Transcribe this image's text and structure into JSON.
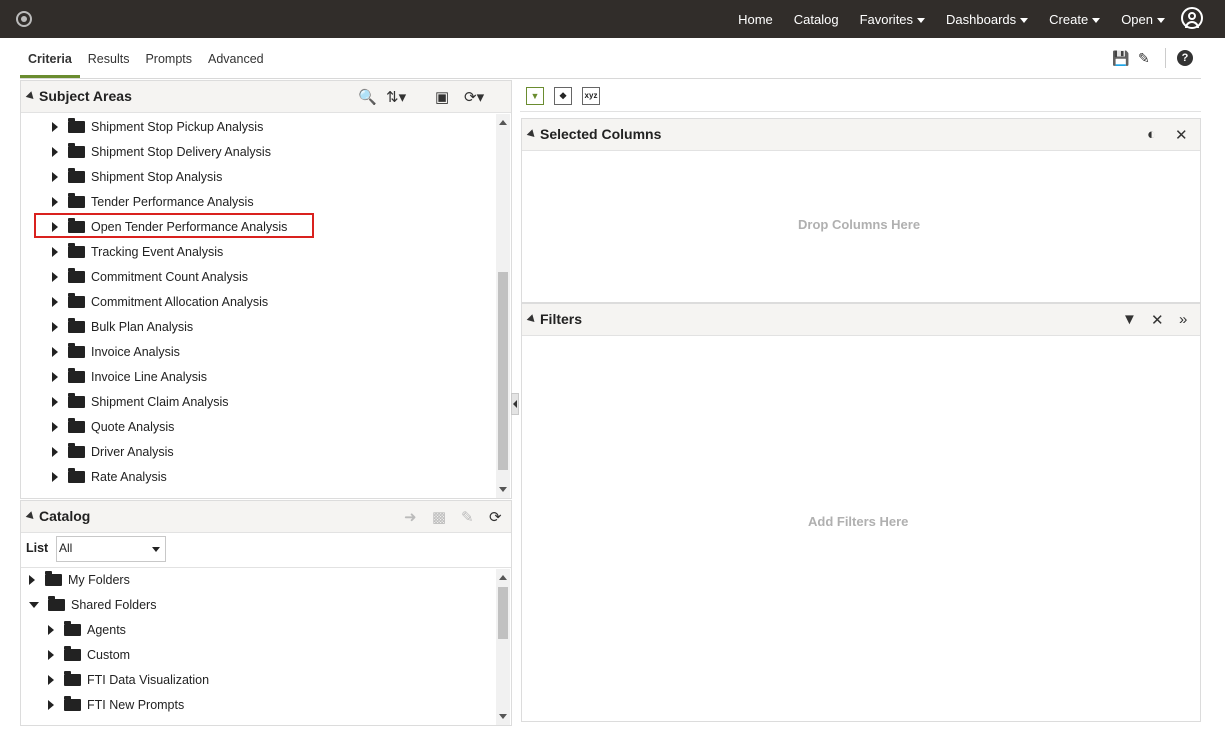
{
  "nav": {
    "home": "Home",
    "catalog": "Catalog",
    "favorites": "Favorites",
    "dashboards": "Dashboards",
    "create": "Create",
    "open": "Open"
  },
  "tabs": [
    "Criteria",
    "Results",
    "Prompts",
    "Advanced"
  ],
  "subject_areas": {
    "title": "Subject Areas",
    "items": [
      "Shipment Stop Pickup Analysis",
      "Shipment Stop Delivery Analysis",
      "Shipment Stop Analysis",
      "Tender Performance Analysis",
      "Open Tender Performance Analysis",
      "Tracking Event Analysis",
      "Commitment Count Analysis",
      "Commitment Allocation Analysis",
      "Bulk Plan Analysis",
      "Invoice Analysis",
      "Invoice Line Analysis",
      "Shipment Claim Analysis",
      "Quote Analysis",
      "Driver Analysis",
      "Rate Analysis"
    ]
  },
  "catalog": {
    "title": "Catalog",
    "list_label": "List",
    "list_value": "All",
    "items": [
      {
        "label": "My Folders",
        "expanded": false,
        "level": 0
      },
      {
        "label": "Shared Folders",
        "expanded": true,
        "level": 0
      },
      {
        "label": "Agents",
        "expanded": false,
        "level": 1
      },
      {
        "label": "Custom",
        "expanded": false,
        "level": 1
      },
      {
        "label": "FTI Data Visualization",
        "expanded": false,
        "level": 1
      },
      {
        "label": "FTI New Prompts",
        "expanded": false,
        "level": 1
      }
    ]
  },
  "selected_columns": {
    "title": "Selected Columns",
    "placeholder": "Drop Columns Here"
  },
  "filters": {
    "title": "Filters",
    "placeholder": "Add Filters Here"
  },
  "toolbar": {
    "xyz_label": "xyz"
  },
  "colors": {
    "topbar": "#312d2a",
    "active_tab_underline": "#6a8c2f",
    "highlight": "#d9211e"
  }
}
